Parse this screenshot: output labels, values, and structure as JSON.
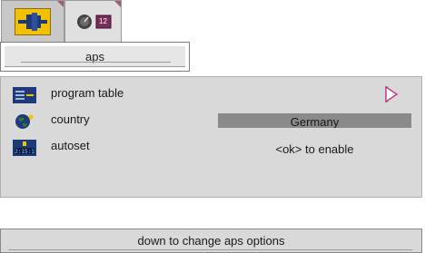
{
  "tabs": [
    {
      "icon": "antenna-connector-icon",
      "active": true
    },
    {
      "icon": "clock-dial-icon",
      "badge": "12",
      "active": false
    }
  ],
  "breadcrumb": {
    "title": "aps"
  },
  "settings": {
    "rows": [
      {
        "icon": "program-table-icon",
        "label": "program table",
        "value": ""
      },
      {
        "icon": "globe-icon",
        "label": "country",
        "value": "Germany"
      },
      {
        "icon": "autoset-icon",
        "label": "autoset",
        "value": "<ok> to enable"
      }
    ]
  },
  "status": {
    "hint": "down to change aps options"
  },
  "colors": {
    "active_tab_icon": "#f2c200",
    "panel_bg": "#d9d9d9",
    "selection_bg": "#8a8a8a",
    "accent": "#d03a8a"
  }
}
